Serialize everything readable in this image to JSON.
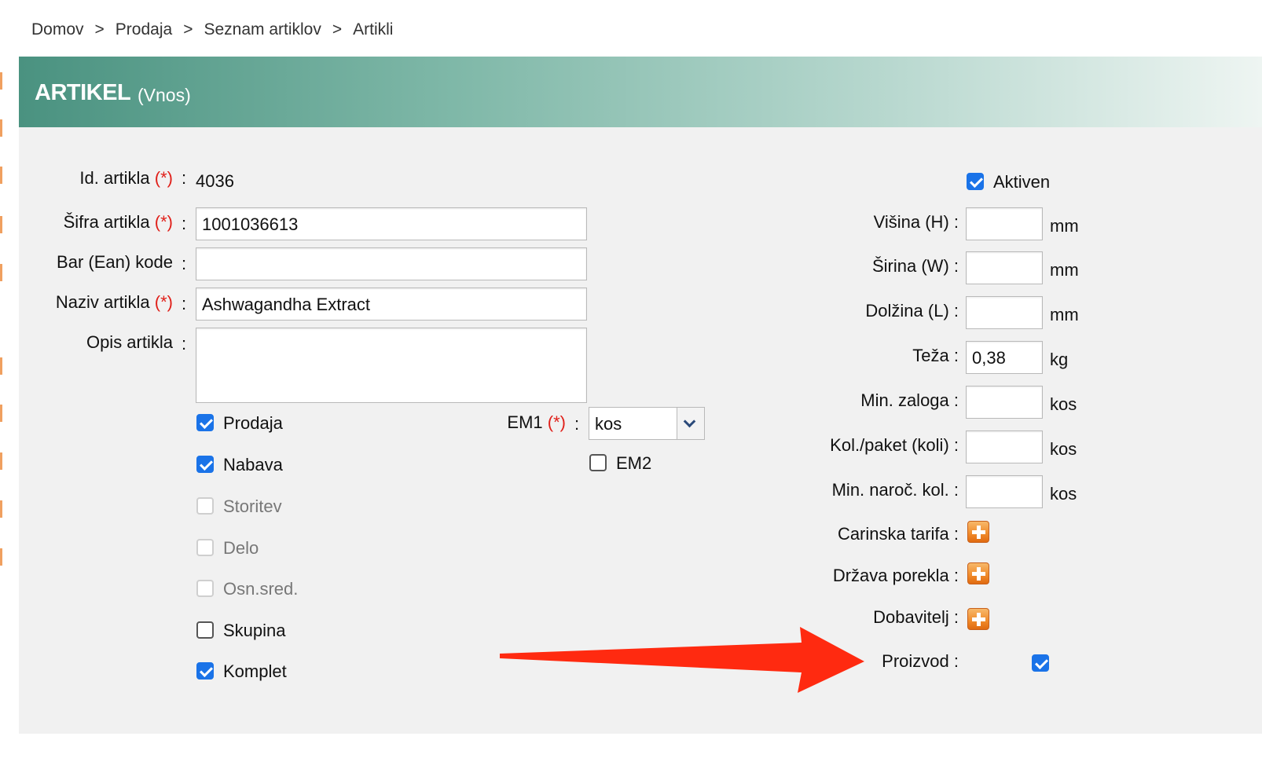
{
  "breadcrumb": {
    "items": [
      "Domov",
      "Prodaja",
      "Seznam artiklov",
      "Artikli"
    ],
    "separator": ">"
  },
  "header": {
    "title": "ARTIKEL",
    "subtitle": "(Vnos)"
  },
  "required_marker": "(*)",
  "colon": ":",
  "left_form": {
    "id_label": "Id. artikla",
    "id_value": "4036",
    "sifra_label": "Šifra artikla",
    "sifra_value": "1001036613",
    "ean_label": "Bar (Ean) kode",
    "ean_value": "",
    "naziv_label": "Naziv artikla",
    "naziv_value": "Ashwagandha Extract",
    "opis_label": "Opis artikla",
    "opis_value": ""
  },
  "checkboxes": [
    {
      "label": "Prodaja",
      "checked": true,
      "disabled": false
    },
    {
      "label": "Nabava",
      "checked": true,
      "disabled": false
    },
    {
      "label": "Storitev",
      "checked": false,
      "disabled": true
    },
    {
      "label": "Delo",
      "checked": false,
      "disabled": true
    },
    {
      "label": "Osn.sred.",
      "checked": false,
      "disabled": true
    },
    {
      "label": "Skupina",
      "checked": false,
      "disabled": false
    },
    {
      "label": "Komplet",
      "checked": true,
      "disabled": false
    }
  ],
  "em1": {
    "label": "EM1",
    "value": "kos"
  },
  "em2": {
    "label": "EM2",
    "checked": false
  },
  "right_form": {
    "aktiven_label": "Aktiven",
    "aktiven_checked": true,
    "visina_label": "Višina (H) :",
    "visina_value": "",
    "visina_unit": "mm",
    "sirina_label": "Širina (W) :",
    "sirina_value": "",
    "sirina_unit": "mm",
    "dolzina_label": "Dolžina (L) :",
    "dolzina_value": "",
    "dolzina_unit": "mm",
    "teza_label": "Teža :",
    "teza_value": "0,38",
    "teza_unit": "kg",
    "min_zaloga_label": "Min. zaloga :",
    "min_zaloga_value": "",
    "min_zaloga_unit": "kos",
    "kol_paket_label": "Kol./paket (koli) :",
    "kol_paket_value": "",
    "kol_paket_unit": "kos",
    "min_naroc_label": "Min. naroč. kol. :",
    "min_naroc_value": "",
    "min_naroc_unit": "kos",
    "carinska_label": "Carinska tarifa :",
    "drzava_label": "Država porekla :",
    "dobavitelj_label": "Dobavitelj :",
    "proizvod_label": "Proizvod :",
    "proizvod_checked": true
  },
  "colors": {
    "header_start": "#4a9280",
    "checkbox_blue": "#1a73e8",
    "required_red": "#e0201a",
    "arrow_red": "#ff2a10",
    "plus_orange": "#f08a2a"
  }
}
